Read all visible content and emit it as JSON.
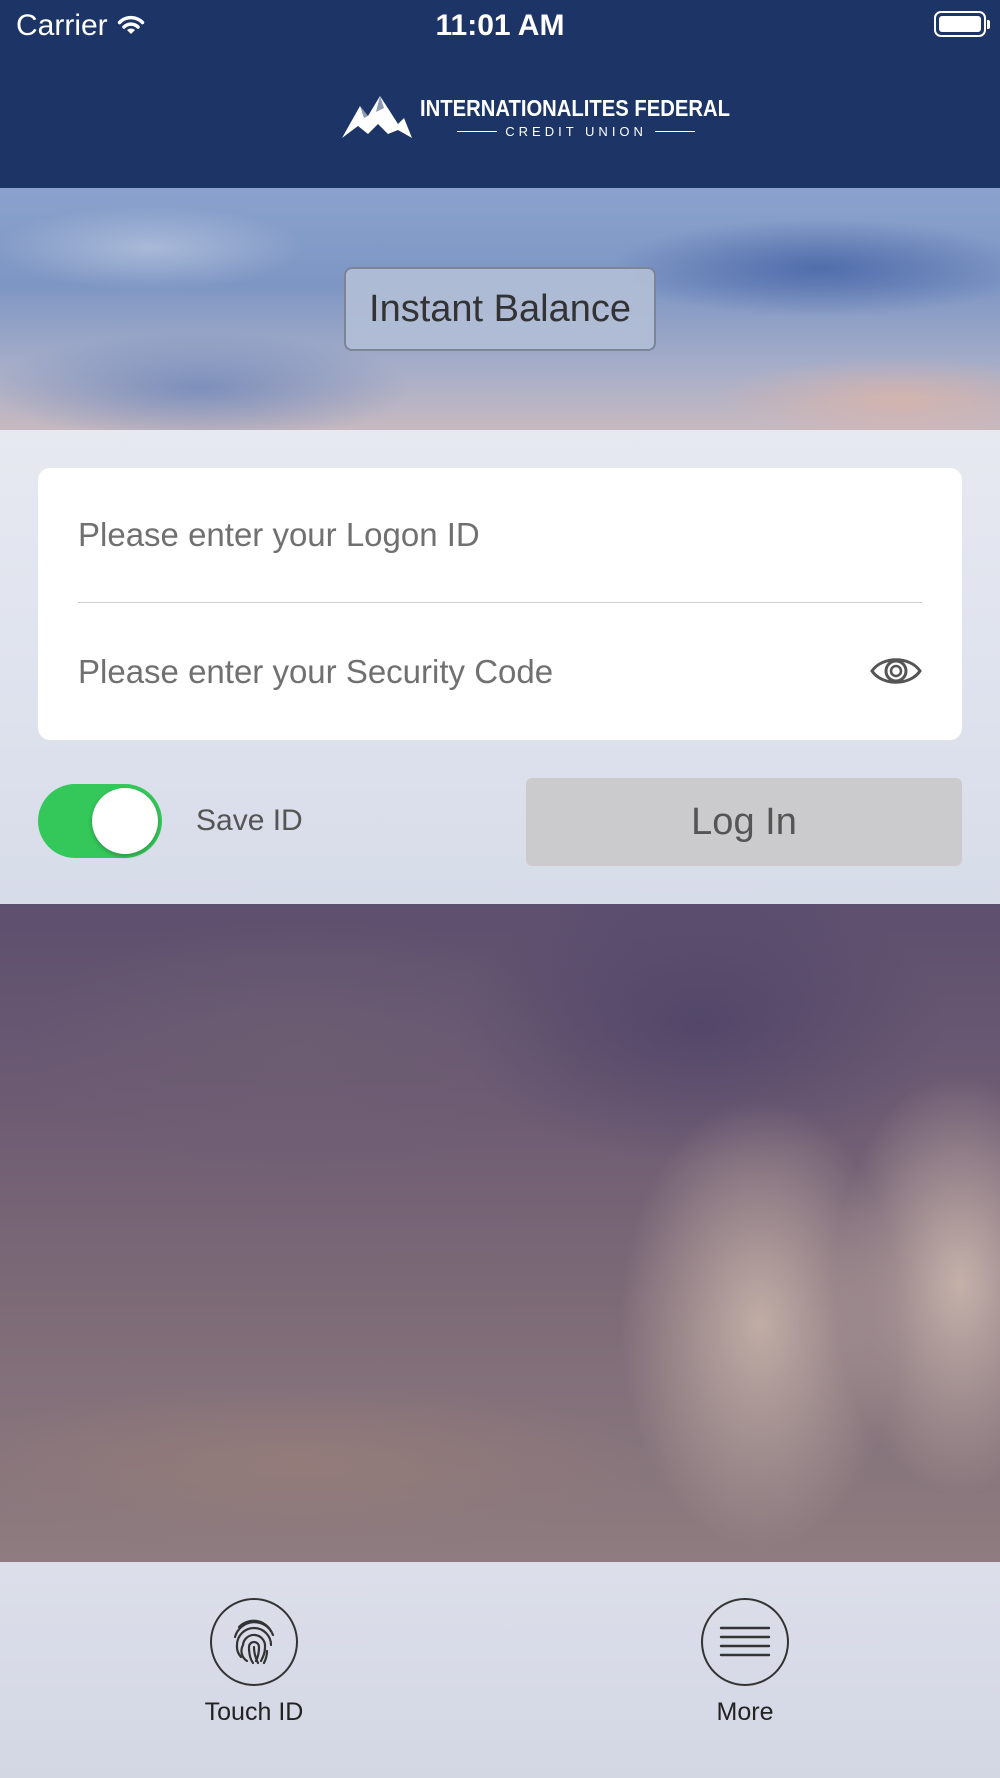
{
  "status_bar": {
    "carrier": "Carrier",
    "time": "11:01 AM"
  },
  "header": {
    "logo_name": "INTERNATIONALITES FEDERAL",
    "logo_sub": "CREDIT UNION",
    "bg_color": "#1c3566"
  },
  "instant_balance": {
    "label": "Instant Balance"
  },
  "login_form": {
    "logon_placeholder": "Please enter your Logon ID",
    "logon_value": "",
    "security_placeholder": "Please enter your Security Code",
    "security_value": "",
    "save_id_label": "Save ID",
    "save_id_on": true,
    "login_label": "Log In",
    "toggle_color": "#34c759"
  },
  "bottom_bar": {
    "items": [
      {
        "label": "Touch ID",
        "icon": "fingerprint-icon"
      },
      {
        "label": "More",
        "icon": "menu-icon"
      }
    ]
  }
}
